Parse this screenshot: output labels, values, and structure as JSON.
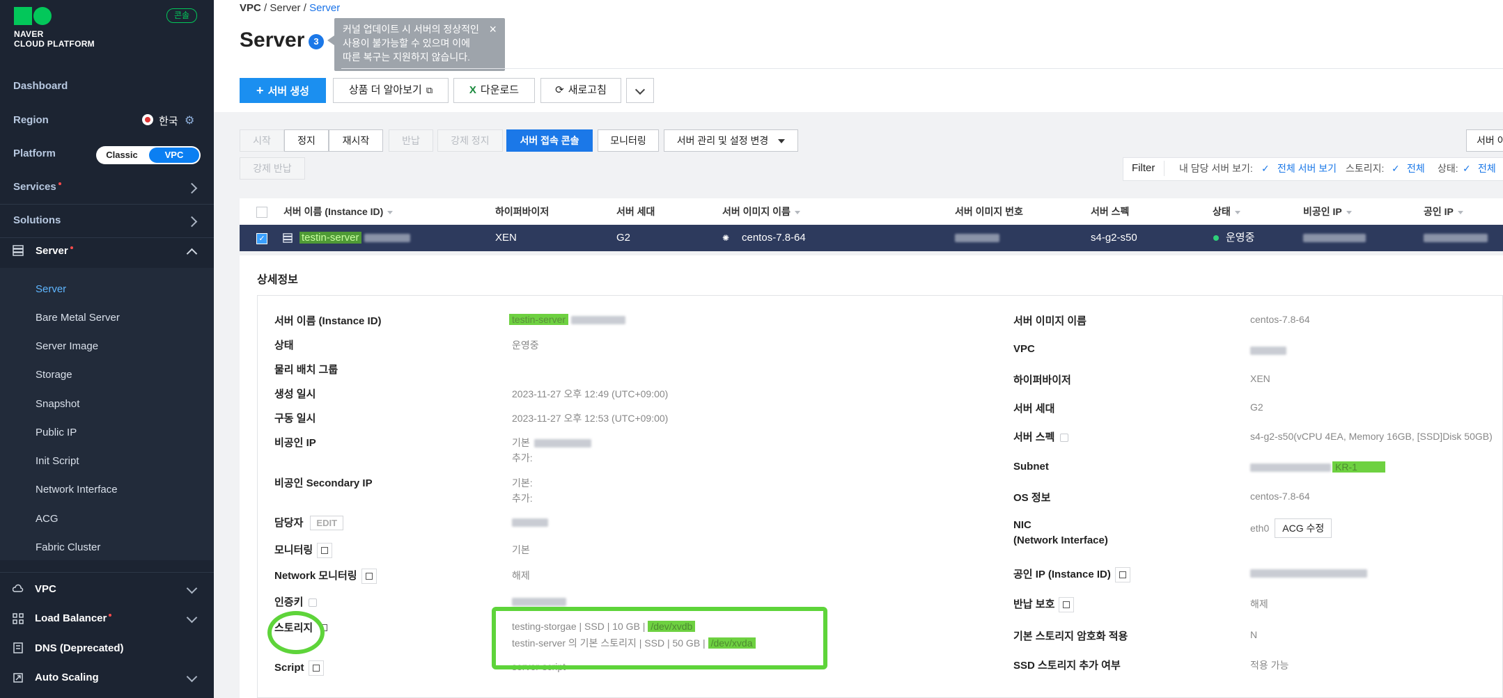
{
  "sidebar": {
    "brand_line1": "NAVER",
    "brand_line2": "CLOUD PLATFORM",
    "console_badge": "콘솔",
    "dashboard": "Dashboard",
    "region_label": "Region",
    "region_value": "한국",
    "platform_label": "Platform",
    "platform_options": [
      "Classic",
      "VPC"
    ],
    "platform_selected": "VPC",
    "services": "Services",
    "solutions": "Solutions",
    "server": "Server",
    "server_sub": [
      "Server",
      "Bare Metal Server",
      "Server Image",
      "Storage",
      "Snapshot",
      "Public IP",
      "Init Script",
      "Network Interface",
      "ACG",
      "Fabric Cluster"
    ],
    "vpc": "VPC",
    "load_balancer": "Load Balancer",
    "dns": "DNS (Deprecated)",
    "auto_scaling": "Auto Scaling"
  },
  "breadcrumb": {
    "items": [
      "VPC",
      "Server",
      "Server"
    ],
    "sep": "/"
  },
  "page": {
    "title": "Server",
    "count": "3"
  },
  "tooltip": {
    "line1": "커널 업데이트 시 서버의 정상적인",
    "line2": "사용이 불가능할 수 있으며 이에",
    "line3": "따른 복구는 지원하지 않습니다.",
    "close": "×"
  },
  "toolbar": {
    "create": "서버 생성",
    "learn_more": "상품 더 알아보기",
    "download": "다운로드",
    "refresh": "새로고침"
  },
  "actions": {
    "start": "시작",
    "stop": "정지",
    "restart": "재시작",
    "return": "반납",
    "force_stop": "강제 정지",
    "console": "서버 접속 콘솔",
    "monitoring": "모니터링",
    "manage": "서버 관리 및 설정 변경",
    "force_return": "강제 반납",
    "right_cut": "서버 이"
  },
  "filter": {
    "label": "Filter",
    "my_servers": "내 담당 서버 보기:",
    "all_servers": "전체 서버 보기",
    "storage": "스토리지:",
    "all": "전체",
    "status": "상태:",
    "all2": "전체"
  },
  "table": {
    "headers": [
      "서버 이름 (Instance ID)",
      "하이퍼바이저",
      "서버 세대",
      "서버 이미지 이름",
      "서버 이미지 번호",
      "서버 스펙",
      "상태",
      "비공인 IP",
      "공인 IP"
    ],
    "row": {
      "name": "testin-server",
      "hypervisor": "XEN",
      "generation": "G2",
      "image": "centos-7.8-64",
      "spec": "s4-g2-s50",
      "status": "운영중"
    }
  },
  "detail": {
    "title": "상세정보",
    "left": {
      "labels": [
        "서버 이름 (Instance ID)",
        "상태",
        "물리 배치 그룹",
        "생성 일시",
        "구동 일시",
        "비공인 IP",
        "비공인 Secondary IP",
        "담당자",
        "모니터링",
        "Network 모니터링",
        "인증키",
        "스토리지",
        "Script"
      ],
      "name": "testin-server",
      "status": "운영중",
      "created": "2023-11-27 오후 12:49 (UTC+09:00)",
      "started": "2023-11-27 오후 12:53 (UTC+09:00)",
      "private_ip_basic": "기본",
      "private_ip_add": "추가:",
      "secondary_basic": "기본:",
      "secondary_add": "추가:",
      "edit": "EDIT",
      "monitoring": "기본",
      "net_monitoring": "해제",
      "storage1_prefix": "testing-storgae | SSD | 10 GB | ",
      "storage1_dev": "/dev/xvdb",
      "storage2_prefix": "testin-server 의 기본 스토리지 | SSD | 50 GB | ",
      "storage2_dev": "/dev/xvda",
      "script": "server-script"
    },
    "right": {
      "labels": [
        "서버 이미지 이름",
        "VPC",
        "하이퍼바이저",
        "서버 세대",
        "서버 스펙",
        "Subnet",
        "OS 정보",
        "NIC",
        "(Network Interface)",
        "공인 IP (Instance ID)",
        "반납 보호",
        "기본 스토리지 암호화 적용",
        "SSD 스토리지 추가 여부"
      ],
      "image": "centos-7.8-64",
      "hypervisor": "XEN",
      "generation": "G2",
      "spec": "s4-g2-s50(vCPU 4EA, Memory 16GB, [SSD]Disk 50GB)",
      "subnet_suffix": "KR-1",
      "os": "centos-7.8-64",
      "nic": "eth0",
      "acg_btn": "ACG 수정",
      "return_protect": "해제",
      "encryption": "N",
      "ssd_add": "적용 가능"
    }
  },
  "colors": {
    "sidebar_bg": "#1c2432",
    "accent": "#1b78e8",
    "brand": "#03c75a",
    "highlight": "#5ed43a",
    "selected_row": "#2d3a5d"
  }
}
